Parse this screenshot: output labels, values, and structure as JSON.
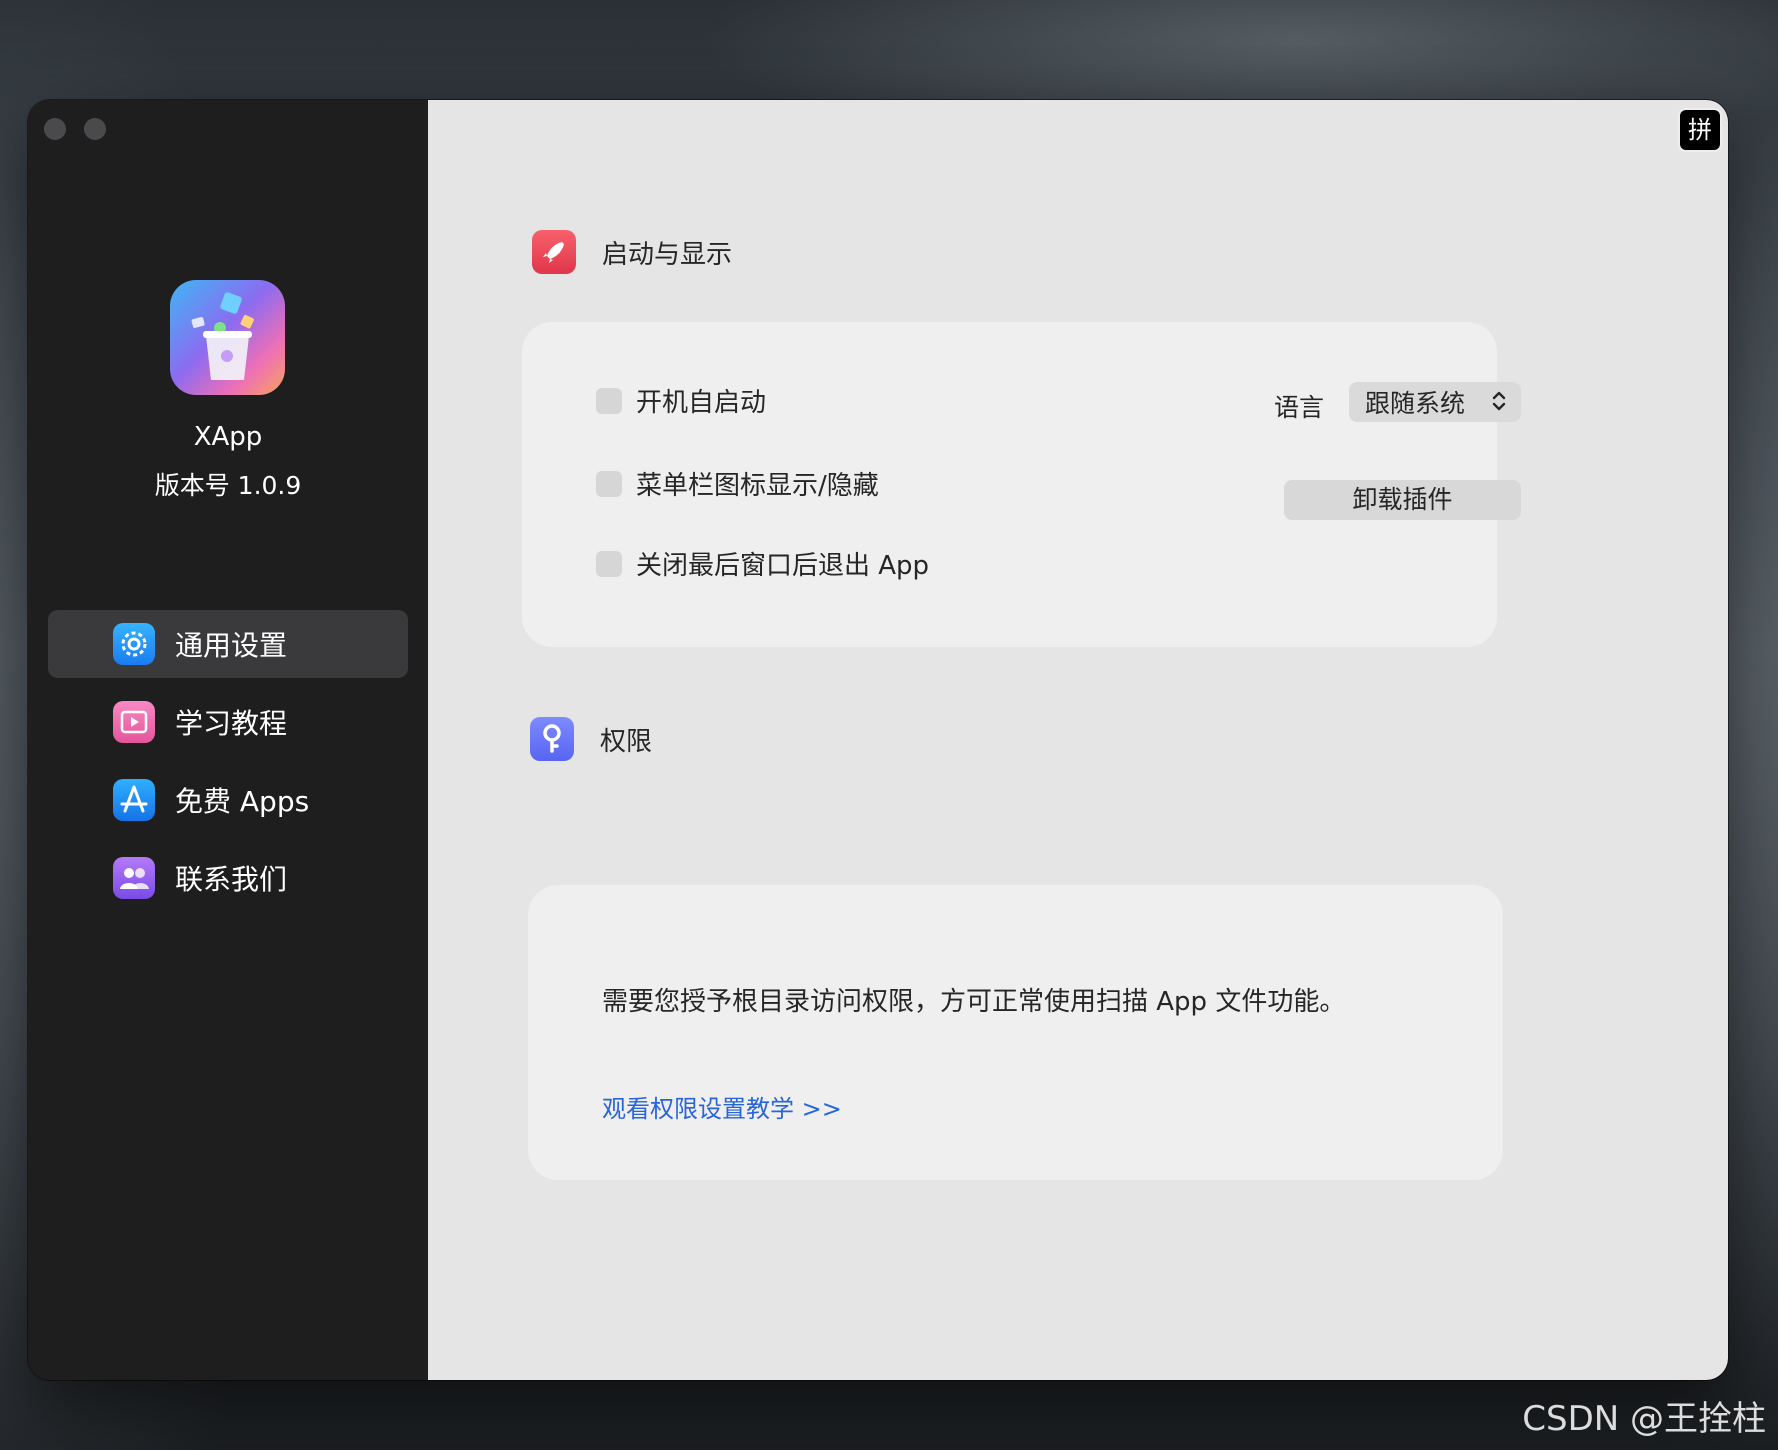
{
  "sidebar": {
    "app_name": "XApp",
    "version": "版本号 1.0.9",
    "items": [
      {
        "label": "通用设置",
        "icon": "gear-icon",
        "active": true
      },
      {
        "label": "学习教程",
        "icon": "video-icon",
        "active": false
      },
      {
        "label": "免费 Apps",
        "icon": "app-store-icon",
        "active": false
      },
      {
        "label": "联系我们",
        "icon": "contacts-icon",
        "active": false
      }
    ]
  },
  "ime_indicator": "拼",
  "startup_section": {
    "title": "启动与显示",
    "icon": "rocket-icon",
    "options": [
      {
        "label": "开机自启动",
        "checked": false
      },
      {
        "label": "菜单栏图标显示/隐藏",
        "checked": false
      },
      {
        "label": "关闭最后窗口后退出 App",
        "checked": false
      }
    ],
    "language_label": "语言",
    "language_value": "跟随系统",
    "uninstall_button": "卸载插件"
  },
  "permission_section": {
    "title": "权限",
    "icon": "key-icon",
    "description": "需要您授予根目录访问权限，方可正常使用扫描 App 文件功能。",
    "link": "观看权限设置教学 >>"
  },
  "watermark": "CSDN @王拴柱",
  "colors": {
    "sidebar_bg": "#1e1e1e",
    "main_bg": "#e4e5e4",
    "card_bg": "#efefef",
    "link": "#2765d9"
  }
}
